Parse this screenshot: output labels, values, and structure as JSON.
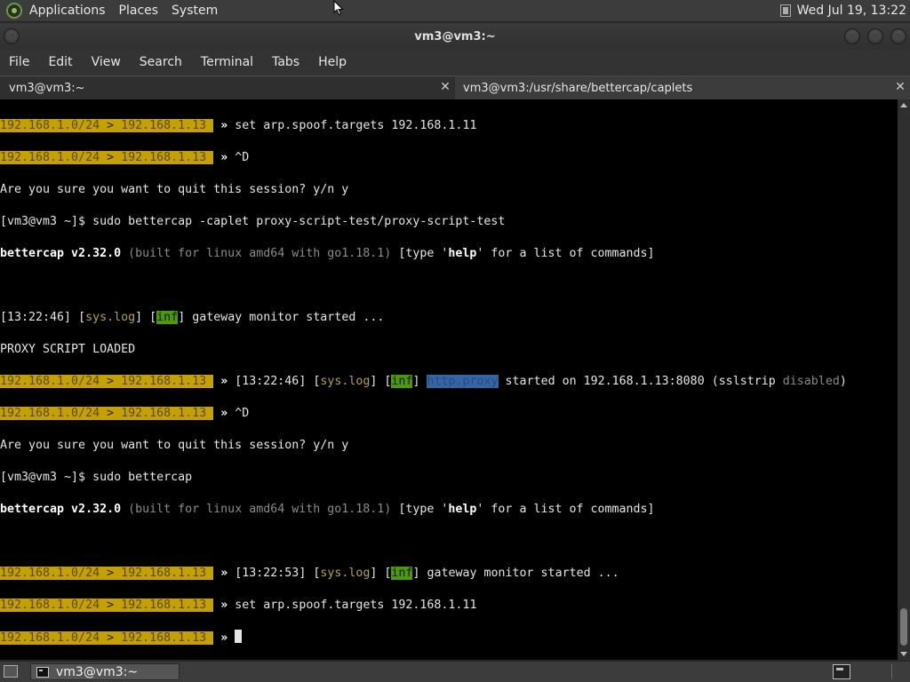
{
  "top_panel": {
    "menus": [
      "Applications",
      "Places",
      "System"
    ],
    "clock": "Wed Jul 19, 13:22"
  },
  "window": {
    "title": "vm3@vm3:~"
  },
  "menubar": {
    "items": [
      "File",
      "Edit",
      "View",
      "Search",
      "Terminal",
      "Tabs",
      "Help"
    ]
  },
  "tabs": [
    {
      "label": "vm3@vm3:~",
      "active": true
    },
    {
      "label": "vm3@vm3:/usr/share/bettercap/caplets",
      "active": false
    }
  ],
  "terminal": {
    "prompt_net": "192.168.1.0/24",
    "prompt_sep": ">",
    "prompt_ip": "192.168.1.13",
    "prompt_arrow": "»",
    "l1_cmd": "set arp.spoof.targets 192.168.1.11",
    "l2_cmd": "^D",
    "l3": "Are you sure you want to quit this session? y/n y",
    "l4": "[vm3@vm3 ~]$ sudo bettercap -caplet proxy-script-test/proxy-script-test",
    "l5_name": "bettercap v2.32.0",
    "l5_build": "(built for linux amd64 with go1.18.1)",
    "l5_type_pre": "[type '",
    "l5_help": "help",
    "l5_type_post": "' for a list of commands]",
    "l7_time": "[13:22:46]",
    "sys_log": "sys.log",
    "inf": "inf",
    "gateway_msg": "gateway monitor started ...",
    "l8": "PROXY SCRIPT LOADED",
    "l9_time": "[13:22:46]",
    "http_proxy": "http.proxy",
    "l9_started": "started on 192.168.1.13:8080 (sslstrip",
    "l9_disabled": "disabled",
    "l9_close": ")",
    "l10_cmd": "^D",
    "l11": "Are you sure you want to quit this session? y/n y",
    "l12": "[vm3@vm3 ~]$ sudo bettercap",
    "l13_name": "bettercap v2.32.0",
    "l13_build": "(built for linux amd64 with go1.18.1)",
    "l15_time": "[13:22:53]",
    "l16_cmd": "set arp.spoof.targets 192.168.1.11"
  },
  "taskbar": {
    "item_label": "vm3@vm3:~"
  },
  "colors": {
    "prompt_bg": "#c4a000",
    "inf_bg": "#4e9a06",
    "highlight": "#3465a4",
    "terminal_bg": "#000000"
  }
}
